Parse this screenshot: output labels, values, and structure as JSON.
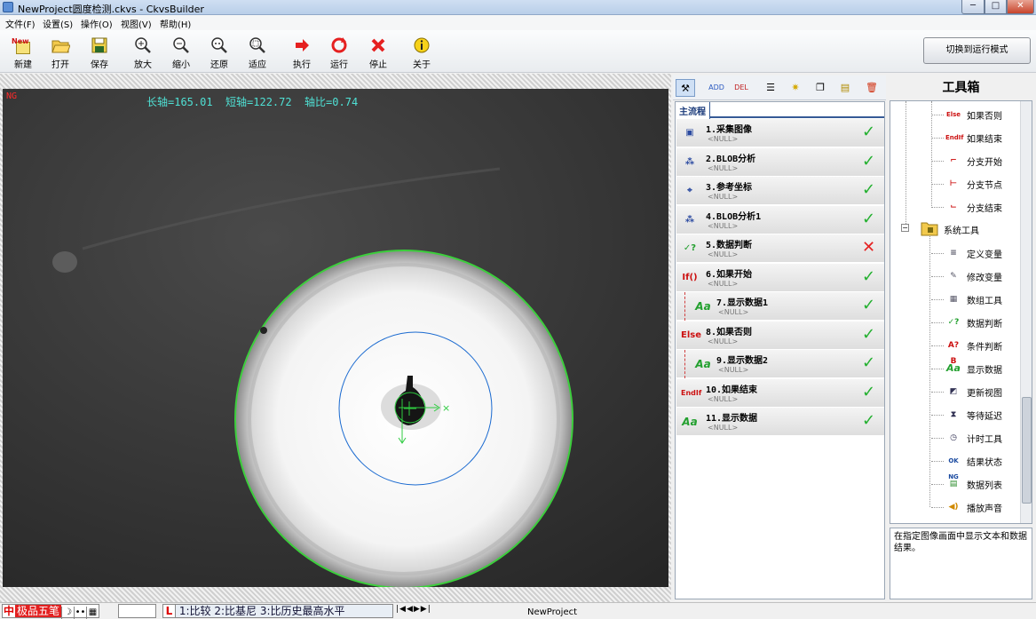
{
  "window": {
    "title": "NewProject圆度检测.ckvs - CkvsBuilder",
    "min": "─",
    "max": "□",
    "close": "✕"
  },
  "menu": [
    "文件(F)",
    "设置(S)",
    "操作(O)",
    "视图(V)",
    "帮助(H)"
  ],
  "toolbar": {
    "buttons": [
      {
        "label": "新建",
        "icon": "new-file-icon"
      },
      {
        "label": "打开",
        "icon": "open-folder-icon"
      },
      {
        "label": "保存",
        "icon": "save-icon"
      },
      {
        "label": "放大",
        "icon": "zoom-in-icon"
      },
      {
        "label": "缩小",
        "icon": "zoom-out-icon"
      },
      {
        "label": "还原",
        "icon": "zoom-reset-icon"
      },
      {
        "label": "适应",
        "icon": "zoom-fit-icon"
      },
      {
        "label": "执行",
        "icon": "execute-icon"
      },
      {
        "label": "运行",
        "icon": "run-loop-icon"
      },
      {
        "label": "停止",
        "icon": "stop-icon"
      },
      {
        "label": "关于",
        "icon": "about-icon"
      }
    ],
    "new_badge": "New",
    "run_mode": "切换到运行模式"
  },
  "viewer": {
    "status": "NG",
    "measurement": "长轴=165.01  短轴=122.72  轴比=0.74"
  },
  "flow": {
    "tab": "主流程",
    "steps": [
      {
        "name": "1.采集图像",
        "null": "<NULL>",
        "result": "ok",
        "icon": "acquire-image-icon",
        "glyph": "▣"
      },
      {
        "name": "2.BLOB分析",
        "null": "<NULL>",
        "result": "ok",
        "icon": "blob-icon",
        "glyph": "⁂"
      },
      {
        "name": "3.参考坐标",
        "null": "<NULL>",
        "result": "ok",
        "icon": "reference-coordinate-icon",
        "glyph": "⌖"
      },
      {
        "name": "4.BLOB分析1",
        "null": "<NULL>",
        "result": "ok",
        "icon": "blob-icon",
        "glyph": "⁂"
      },
      {
        "name": "5.数据判断",
        "null": "<NULL>",
        "result": "bad",
        "icon": "data-judge-icon",
        "glyph": "✓?"
      },
      {
        "name": "6.如果开始",
        "null": "<NULL>",
        "result": "ok",
        "icon": "if-start-icon",
        "glyph": "If()"
      },
      {
        "name": "7.显示数据1",
        "null": "<NULL>",
        "result": "ok",
        "icon": "display-data-icon",
        "glyph": "Aa"
      },
      {
        "name": "8.如果否则",
        "null": "<NULL>",
        "result": "ok",
        "icon": "else-icon",
        "glyph": "Else"
      },
      {
        "name": "9.显示数据2",
        "null": "<NULL>",
        "result": "ok",
        "icon": "display-data-icon",
        "glyph": "Aa"
      },
      {
        "name": "10.如果结束",
        "null": "<NULL>",
        "result": "ok",
        "icon": "endif-icon",
        "glyph": "EndIf"
      },
      {
        "name": "11.显示数据",
        "null": "<NULL>",
        "result": "ok",
        "icon": "display-data-icon",
        "glyph": "Aa"
      }
    ],
    "ok_mark": "✓",
    "bad_mark": "✕"
  },
  "toolbox": {
    "title": "工具箱",
    "items": [
      {
        "label": "如果否则",
        "icon": "else-icon",
        "glyph": "Else",
        "color": "#cc1111"
      },
      {
        "label": "如果结束",
        "icon": "endif-icon",
        "glyph": "EndIf",
        "color": "#cc1111"
      },
      {
        "label": "分支开始",
        "icon": "branch-start-icon",
        "glyph": "⌐",
        "color": "#d02020"
      },
      {
        "label": "分支节点",
        "icon": "branch-node-icon",
        "glyph": "⊢",
        "color": "#d02020"
      },
      {
        "label": "分支结束",
        "icon": "branch-end-icon",
        "glyph": "⌙",
        "color": "#d02020"
      }
    ],
    "group": {
      "label": "系统工具",
      "icon": "folder-icon",
      "expander": "−"
    },
    "system_items": [
      {
        "label": "定义变量",
        "icon": "define-variable-icon",
        "glyph": "≡",
        "color": "#556"
      },
      {
        "label": "修改变量",
        "icon": "modify-variable-icon",
        "glyph": "✎",
        "color": "#556"
      },
      {
        "label": "数组工具",
        "icon": "array-tool-icon",
        "glyph": "▦",
        "color": "#556"
      },
      {
        "label": "数据判断",
        "icon": "data-judge-icon",
        "glyph": "✓?",
        "color": "#23a02f"
      },
      {
        "label": "条件判断",
        "icon": "condition-judge-icon",
        "glyph": "A?B",
        "color": "#cc1111"
      },
      {
        "label": "显示数据",
        "icon": "display-data-icon",
        "glyph": "Aa",
        "color": "#23a02f"
      },
      {
        "label": "更新视图",
        "icon": "update-view-icon",
        "glyph": "◩",
        "color": "#335"
      },
      {
        "label": "等待延迟",
        "icon": "hourglass-icon",
        "glyph": "⧗",
        "color": "#335"
      },
      {
        "label": "计时工具",
        "icon": "timer-icon",
        "glyph": "◷",
        "color": "#335"
      },
      {
        "label": "结果状态",
        "icon": "ok-ng-icon",
        "glyph": "OK NG",
        "color": "#1a4aa0"
      },
      {
        "label": "数据列表",
        "icon": "data-list-icon",
        "glyph": "▤",
        "color": "#2a8a2a"
      },
      {
        "label": "播放声音",
        "icon": "speaker-icon",
        "glyph": "◀)",
        "color": "#d08a00"
      }
    ],
    "description": "在指定图像画面中显示文本和数据结果。"
  },
  "statusbar": {
    "ime_logo": "中",
    "ime_name": "极品五笔",
    "ime_moon": "☽",
    "ime_dot": "••",
    "ime_keyboard": "▦",
    "candidates_logo": "L",
    "candidates": "1:比较 2:比基尼 3:比历史最高水平",
    "candidate_nav": "|◀◀▶▶|",
    "project": "NewProject"
  }
}
